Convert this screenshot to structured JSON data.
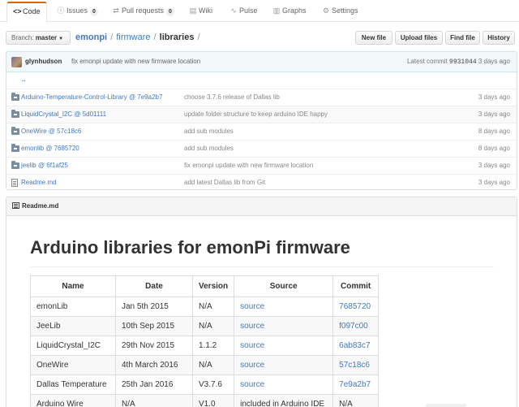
{
  "tabs": [
    {
      "label": "Code",
      "icon": "code-icon",
      "glyph": "<>"
    },
    {
      "label": "Issues",
      "icon": "issue-icon",
      "glyph": "ⓘ",
      "count": "0"
    },
    {
      "label": "Pull requests",
      "icon": "pull-request-icon",
      "glyph": "⇄",
      "count": "0"
    },
    {
      "label": "Wiki",
      "icon": "book-icon",
      "glyph": "▤"
    },
    {
      "label": "Pulse",
      "icon": "pulse-icon",
      "glyph": "∿"
    },
    {
      "label": "Graphs",
      "icon": "graph-icon",
      "glyph": "▥"
    },
    {
      "label": "Settings",
      "icon": "gear-icon",
      "glyph": "⚙"
    }
  ],
  "branch": {
    "prefix": "Branch:",
    "name": "master"
  },
  "breadcrumb": {
    "repo": "emonpi",
    "folder": "firmware",
    "current": "libraries",
    "sep": "/"
  },
  "actions": {
    "new_file": "New file",
    "upload": "Upload files",
    "find": "Find file",
    "history": "History"
  },
  "commit": {
    "author": "glynhudson",
    "message": "fix emonpi update with new firmware location",
    "latest_label": "Latest commit",
    "sha": "9931044",
    "age": "3 days ago"
  },
  "files": {
    "up": "..",
    "rows": [
      {
        "name": "Arduino-Temperature-Control-Library @ 7e9a2b7",
        "message": "choose 3.7.6 release of Dallas lib",
        "age": "3 days ago",
        "kind": "submodule"
      },
      {
        "name": "LiquidCrystal_I2C @ 5d01111",
        "message": "update folder structure to keep arduino IDE happy",
        "age": "3 days ago",
        "kind": "submodule"
      },
      {
        "name": "OneWire @ 57c18c6",
        "message": "add sub modules",
        "age": "8 days ago",
        "kind": "submodule"
      },
      {
        "name": "emonlib @ 7685720",
        "message": "add sub modules",
        "age": "8 days ago",
        "kind": "submodule"
      },
      {
        "name": "jeelib @ 6f1af25",
        "message": "fix emonpi update with new firmware location",
        "age": "3 days ago",
        "kind": "submodule"
      },
      {
        "name": "Readme.md",
        "message": "add latest Dallas lib from Git",
        "age": "3 days ago",
        "kind": "file"
      }
    ]
  },
  "readme": {
    "filename": "Readme.md",
    "heading": "Arduino libraries for emonPi firmware",
    "table": {
      "headers": [
        "Name",
        "Date",
        "Version",
        "Source",
        "Commit"
      ],
      "rows": [
        [
          "emonLib",
          "Jan 5th 2015",
          "N/A",
          "source",
          "7685720"
        ],
        [
          "JeeLib",
          "10th Sep 2015",
          "N/A",
          "source",
          "f097c00"
        ],
        [
          "LiquidCrystal_I2C",
          "29th Nov 2015",
          "1.1.2",
          "source",
          "6ab83c7"
        ],
        [
          "OneWire",
          "4th March 2016",
          "N/A",
          "source",
          "57c18c6"
        ],
        [
          "Dallas Temperature",
          "25th Jan 2016",
          "V3.7.6",
          "source",
          "7e9a2b7"
        ],
        [
          "Arduino Wire",
          "N/A",
          "V1.0",
          "included in Arduino IDE",
          "N/A"
        ]
      ]
    }
  }
}
